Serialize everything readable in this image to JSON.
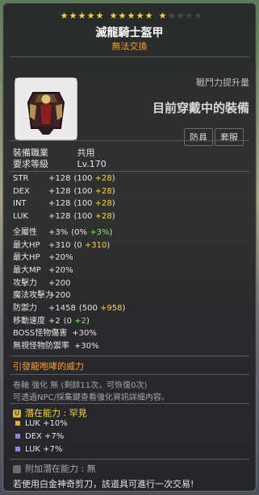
{
  "header": {
    "stars": {
      "filled": 11,
      "total": 15
    },
    "title": "滅龍騎士盔甲",
    "subtitle": "無法交換"
  },
  "combat": {
    "label": "戰鬥力提升量",
    "value": "目前穿戴中的裝備"
  },
  "tabs": [
    {
      "label": "防具"
    },
    {
      "label": "套服"
    }
  ],
  "requirements": {
    "job_label": "裝備職業",
    "job_value": "共用",
    "level_label": "要求等級",
    "level_value": "Lv.170"
  },
  "stats": [
    {
      "name": "STR",
      "value": "+128",
      "base": "(100",
      "bonus": "+28",
      "close": ")"
    },
    {
      "name": "DEX",
      "value": "+128",
      "base": "(100",
      "bonus": "+28",
      "close": ")"
    },
    {
      "name": "INT",
      "value": "+128",
      "base": "(100",
      "bonus": "+28",
      "close": ")"
    },
    {
      "name": "LUK",
      "value": "+128",
      "base": "(100",
      "bonus": "+28",
      "close": ")"
    },
    {
      "name": "全屬性",
      "value": "+3%",
      "base": "(0%",
      "bonus": "+3%",
      "close": ")",
      "bonus_color": "green"
    },
    {
      "name": "最大HP",
      "value": "+310",
      "base": "(0",
      "bonus": "+310",
      "close": ")"
    },
    {
      "name": "最大HP",
      "value": "+20%"
    },
    {
      "name": "最大MP",
      "value": "+20%"
    },
    {
      "name": "攻擊力",
      "value": "+200"
    },
    {
      "name": "魔法攻擊力",
      "value": "+200"
    },
    {
      "name": "防禦力",
      "value": "+1458",
      "base": "(500",
      "bonus": "+958",
      "close": ")"
    },
    {
      "name": "移動速度",
      "value": "+2",
      "base": "(0",
      "bonus": "+2",
      "close": ")",
      "bonus_color": "green"
    },
    {
      "name": "BOSS怪物傷害",
      "value": "+30%"
    },
    {
      "name": "無視怪物防禦率",
      "value": "+30%"
    }
  ],
  "special_effect": "引發龍咆哮的威力",
  "upgrade": {
    "line1": "卷軸 強化 無 (剩餘11次，可恢復0次)",
    "line2": "可透過NPC/採集鍵查看強化資訊詳細內容。"
  },
  "potential": {
    "label": "潛在能力 : 罕見",
    "lines": [
      {
        "text": "LUK +10%",
        "dot_color": "#d8b33a"
      },
      {
        "text": "DEX +7%",
        "dot_color": "#8f86d8"
      },
      {
        "text": "LUK +7%",
        "dot_color": "#8f86d8"
      }
    ]
  },
  "additional_potential": {
    "label": "附加潛在能力 : 無"
  },
  "footer": "若使用白金神奇剪刀，該道具可進行一次交易!"
}
